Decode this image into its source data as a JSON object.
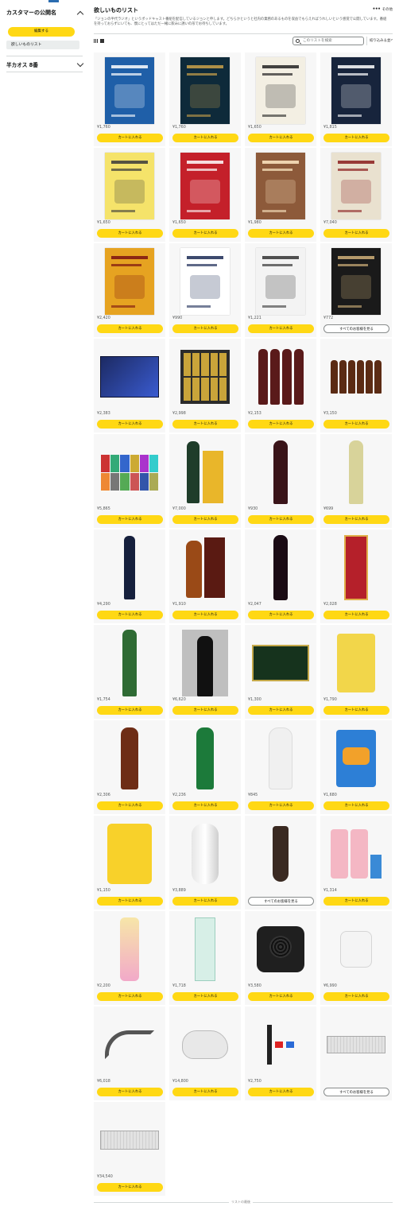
{
  "sidebar": {
    "public_title": "カスタマーの公開名",
    "edit_label": "編集する",
    "list_item": "欲しいものリスト",
    "section2_title": "半カオス 8番"
  },
  "header": {
    "title": "欲しいものリスト",
    "more_label": "その他",
    "description": "「ジョンの半代ラジオ」というポッドキャスト番組を配信しているジョンと申します。どちらかというと社内の業務のあるものを収益でもらえればうれしいという感覚で公開しています。番組を持っておらずにいても、僕にとってはただ一緒に飲みに誘いの形でお待ちしています。",
    "search_placeholder": "このリストを検索",
    "filter_label": "絞り込み＆並べ替え"
  },
  "colors": {
    "accent": "#ffd814",
    "background": "#ffffff",
    "card": "#f7f7f7"
  },
  "items": [
    {
      "price": "¥1,760",
      "button": "カートに入れる",
      "icon": "book-buddhist-thought"
    },
    {
      "price": "¥1,760",
      "button": "カートに入れる",
      "icon": "book-100-man"
    },
    {
      "price": "¥1,650",
      "button": "カートに入れる",
      "icon": "book-instant-language"
    },
    {
      "price": "¥1,815",
      "button": "カートに入れる",
      "icon": "book-no-need-motivation"
    },
    {
      "price": "¥1,650",
      "button": "カートに入れる",
      "icon": "book-cover-yellow"
    },
    {
      "price": "¥1,650",
      "button": "カートに入れる",
      "icon": "book-top-5-leader"
    },
    {
      "price": "¥1,980",
      "button": "カートに入れる",
      "icon": "book-world-churches"
    },
    {
      "price": "¥7,040",
      "button": "カートに入れる",
      "icon": "book-western-paintings"
    },
    {
      "price": "¥2,420",
      "button": "カートに入れる",
      "icon": "book-world-scenery-1160"
    },
    {
      "price": "¥990",
      "button": "カートに入れる",
      "icon": "book-philosophy"
    },
    {
      "price": "¥1,221",
      "button": "カートに入れる",
      "icon": "book-consciousness"
    },
    {
      "price": "¥772",
      "button": "すべてのお客様を見る",
      "icon": "book-rakujitsu",
      "alt": true
    },
    {
      "price": "¥2,383",
      "button": "カートに入れる",
      "icon": "beer-box"
    },
    {
      "price": "¥2,998",
      "button": "カートに入れる",
      "icon": "beer-gift-set"
    },
    {
      "price": "¥2,153",
      "button": "カートに入れる",
      "icon": "beer-bottles-four"
    },
    {
      "price": "¥3,150",
      "button": "カートに入れる",
      "icon": "craft-beer-set"
    },
    {
      "price": "¥5,865",
      "button": "カートに入れる",
      "icon": "beer-cans-assort"
    },
    {
      "price": "¥7,000",
      "button": "カートに入れる",
      "icon": "champagne-bottle"
    },
    {
      "price": "¥930",
      "button": "カートに入れる",
      "icon": "red-wine-bottle"
    },
    {
      "price": "¥699",
      "button": "カートに入れる",
      "icon": "white-wine-bottle"
    },
    {
      "price": "¥4,290",
      "button": "カートに入れる",
      "icon": "dessert-wine-bottle"
    },
    {
      "price": "¥1,910",
      "button": "カートに入れる",
      "icon": "brandy-bottle-box"
    },
    {
      "price": "¥2,047",
      "button": "カートに入れる",
      "icon": "plum-liqueur-bottle"
    },
    {
      "price": "¥2,028",
      "button": "カートに入れる",
      "icon": "choya-umeshu"
    },
    {
      "price": "¥1,754",
      "button": "カートに入れる",
      "icon": "sake-bottle-green"
    },
    {
      "price": "¥6,620",
      "button": "カートに入れる",
      "icon": "shochu-bottle-black"
    },
    {
      "price": "¥1,300",
      "button": "カートに入れる",
      "icon": "green-tea-box"
    },
    {
      "price": "¥1,790",
      "button": "カートに入れる",
      "icon": "lipton-pouch"
    },
    {
      "price": "¥2,306",
      "button": "カートに入れる",
      "icon": "craft-cola-bottle"
    },
    {
      "price": "¥2,236",
      "button": "カートに入れる",
      "icon": "green-tea-bottle"
    },
    {
      "price": "¥845",
      "button": "カートに入れる",
      "icon": "white-water-bottle"
    },
    {
      "price": "¥1,680",
      "button": "カートに入れる",
      "icon": "gummy-candy-pack"
    },
    {
      "price": "¥1,150",
      "button": "カートに入れる",
      "icon": "vitamin-c-serum"
    },
    {
      "price": "¥3,889",
      "button": "カートに入れる",
      "icon": "white-cosmetic-device"
    },
    {
      "price": "",
      "button": "すべてのお客様を見る",
      "icon": "face-wash-tube",
      "alt": true
    },
    {
      "price": "¥1,314",
      "button": "カートに入れる",
      "icon": "pink-cream-tubes"
    },
    {
      "price": "¥2,200",
      "button": "カートに入れる",
      "icon": "pink-lotion-bottle"
    },
    {
      "price": "¥1,718",
      "button": "カートに入れる",
      "icon": "mint-cosmetic-box"
    },
    {
      "price": "¥3,580",
      "button": "カートに入れる",
      "icon": "mini-heater"
    },
    {
      "price": "¥6,990",
      "button": "カートに入れる",
      "icon": "usb-charger"
    },
    {
      "price": "¥6,018",
      "button": "カートに入れる",
      "icon": "bluetooth-headset"
    },
    {
      "price": "¥14,800",
      "button": "カートに入れる",
      "icon": "wireless-mouse"
    },
    {
      "price": "¥2,750",
      "button": "カートに入れる",
      "icon": "usb-adapter-set"
    },
    {
      "price": "",
      "button": "すべてのお客様を見る",
      "icon": "keyboard-white",
      "alt": true
    },
    {
      "price": "¥34,540",
      "button": "カートに入れる",
      "icon": "keyboard-white-2"
    }
  ],
  "footer": {
    "end_label": "リストの最後"
  }
}
